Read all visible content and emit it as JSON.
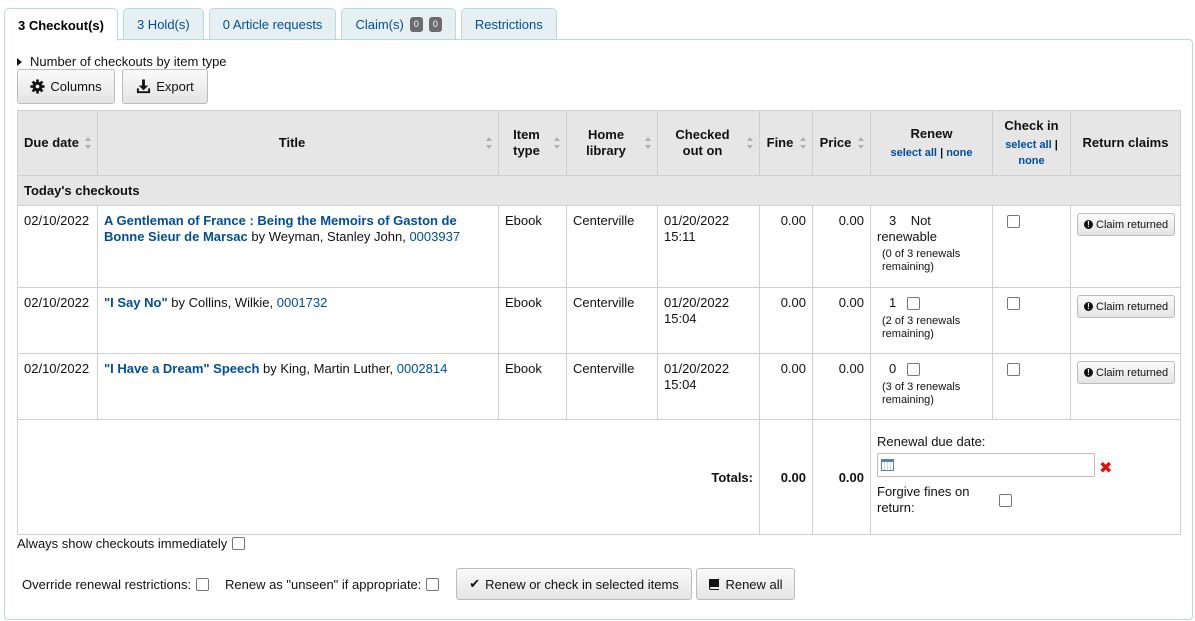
{
  "tabs": [
    {
      "label": "3 Checkout(s)",
      "active": true
    },
    {
      "label": "3 Hold(s)"
    },
    {
      "label": "0 Article requests"
    },
    {
      "label": "Claim(s)",
      "badges": [
        "0",
        "0"
      ]
    },
    {
      "label": "Restrictions"
    }
  ],
  "toggle_label": "Number of checkouts by item type",
  "toolbar": {
    "columns_label": "Columns",
    "export_label": "Export"
  },
  "table": {
    "headers": {
      "due": "Due date",
      "title": "Title",
      "itemtype": "Item type",
      "library": "Home library",
      "checkedout": "Checked out on",
      "fine": "Fine",
      "price": "Price",
      "renew": "Renew",
      "checkin": "Check in",
      "claims": "Return claims"
    },
    "select_all": "select all",
    "sep": "|",
    "none": "none",
    "group_label": "Today's checkouts",
    "rows": [
      {
        "due": "02/10/2022",
        "title": "A Gentleman of France : Being the Memoirs of Gaston de Bonne Sieur de Marsac",
        "by": "by Weyman, Stanley John,",
        "barcode": "0003937",
        "itemtype": "Ebook",
        "library": "Centerville",
        "checkedout_date": "01/20/2022",
        "checkedout_time": "15:11",
        "fine": "0.00",
        "price": "0.00",
        "renew_count": "3",
        "renew_status": "Not renewable",
        "renew_remaining": "(0 of 3 renewals remaining)",
        "claim_label": "Claim returned"
      },
      {
        "due": "02/10/2022",
        "title": "\"I Say No\"",
        "by": "by Collins, Wilkie,",
        "barcode": "0001732",
        "itemtype": "Ebook",
        "library": "Centerville",
        "checkedout_date": "01/20/2022",
        "checkedout_time": "15:04",
        "fine": "0.00",
        "price": "0.00",
        "renew_count": "1",
        "renew_remaining": "(2 of 3 renewals remaining)",
        "claim_label": "Claim returned"
      },
      {
        "due": "02/10/2022",
        "title": "\"I Have a Dream\" Speech",
        "by": "by King, Martin Luther,",
        "barcode": "0002814",
        "itemtype": "Ebook",
        "library": "Centerville",
        "checkedout_date": "01/20/2022",
        "checkedout_time": "15:04",
        "fine": "0.00",
        "price": "0.00",
        "renew_count": "0",
        "renew_remaining": "(3 of 3 renewals remaining)",
        "claim_label": "Claim returned"
      }
    ],
    "totals": {
      "label": "Totals:",
      "fine": "0.00",
      "price": "0.00",
      "renewal_due_label": "Renewal due date:",
      "forgive_label": "Forgive fines on return:"
    }
  },
  "always_show_label": "Always show checkouts immediately",
  "override_label": "Override renewal restrictions:",
  "unseen_label": "Renew as \"unseen\" if appropriate:",
  "renew_selected_label": "Renew or check in selected items",
  "renew_all_label": "Renew all",
  "colors": {
    "link": "#004d99",
    "header_bg": "#e6e6e6",
    "tab_bg": "#e6f0f2",
    "tab_border": "#b9d8d9",
    "clear_red": "#dd1111"
  }
}
